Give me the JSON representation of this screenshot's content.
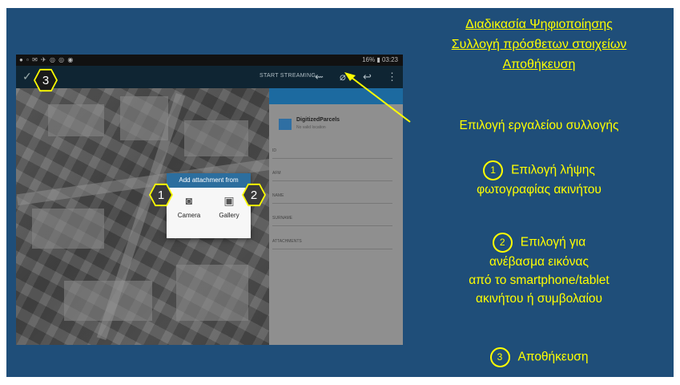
{
  "colors": {
    "background": "#1f4e79",
    "accent": "#ffff00",
    "dialog_header": "#2c6e9e"
  },
  "heading": {
    "line1": "Διαδικασία Ψηφιοποίησης",
    "line2": "Συλλογή πρόσθετων στοιχείων",
    "line3": "Αποθήκευση"
  },
  "tool_label": "Επιλογή εργαλείου συλλογής",
  "steps": [
    {
      "num": "1",
      "lines": [
        "Επιλογή λήψης",
        "φωτογραφίας ακινήτου"
      ]
    },
    {
      "num": "2",
      "lines": [
        "Επιλογή για",
        "ανέβασμα εικόνας",
        "από το smartphone/tablet",
        "ακινήτου ή συμβολαίου"
      ]
    },
    {
      "num": "3",
      "lines": [
        "Αποθήκευση"
      ]
    }
  ],
  "markers": {
    "m1": "1",
    "m2": "2",
    "m3": "3"
  },
  "screenshot": {
    "status_time": "16% ▮ 03:23",
    "start_streaming": "START STREAMING",
    "icons": [
      "check-icon",
      "gps-icon",
      "paperclip-icon",
      "undo-icon",
      "more-icon"
    ],
    "form": {
      "layer_name": "DigitizedParcels",
      "layer_sub": "No valid location",
      "fields": [
        "ID",
        "AFM",
        "NAME",
        "SURNAME",
        "ATTACHMENTS"
      ]
    },
    "dialog": {
      "title": "Add attachment from",
      "camera_label": "Camera",
      "gallery_label": "Gallery"
    }
  }
}
